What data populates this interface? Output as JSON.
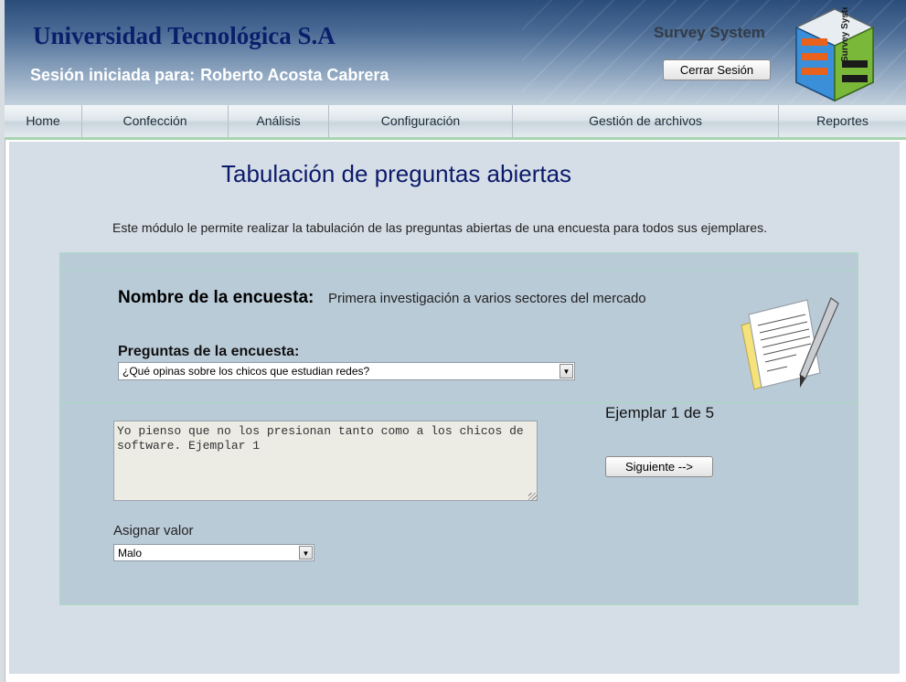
{
  "header": {
    "university": "Universidad Tecnológica S.A",
    "session_label": "Sesión iniciada para:",
    "user_name": "Roberto Acosta Cabrera",
    "app_name": "Survey System",
    "logout_label": "Cerrar Sesión",
    "logo_text": "Survey System",
    "logo_icon": "survey-system-logo"
  },
  "nav": {
    "items": [
      {
        "label": "Home"
      },
      {
        "label": "Confección"
      },
      {
        "label": "Análisis"
      },
      {
        "label": "Configuración"
      },
      {
        "label": "Gestión de archivos"
      },
      {
        "label": "Reportes"
      }
    ]
  },
  "main": {
    "title": "Tabulación de preguntas abiertas",
    "intro": "Este módulo le permite realizar la tabulación de las preguntas abiertas de una encuesta para todos sus ejemplares.",
    "survey_name_label": "Nombre de la encuesta:",
    "survey_name_value": "Primera investigación a varios sectores del mercado",
    "questions_label": "Preguntas de la encuesta:",
    "question_selected": "¿Qué opinas sobre los chicos que estudian redes?",
    "answer_text": "Yo pienso que no los presionan tanto como a los chicos de software. Ejemplar 1",
    "counter": "Ejemplar 1 de 5",
    "next_label": "Siguiente -->",
    "assign_label": "Asignar valor",
    "assign_selected": "Malo",
    "illustration_icon": "notepad-pen-icon"
  },
  "colors": {
    "header_dark": "#2b4d7a",
    "title_blue": "#0c1a6b",
    "panel_bg": "#bacbd8",
    "content_bg": "#d5dee6",
    "panel_border": "#a8d9c0"
  }
}
